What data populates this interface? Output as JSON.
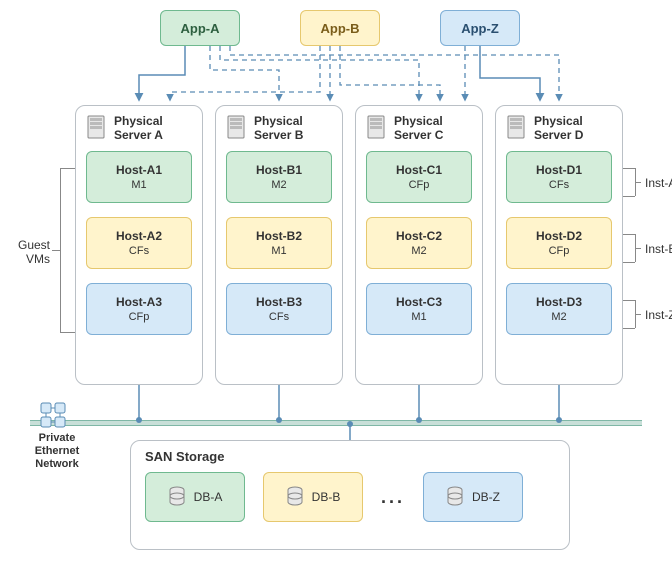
{
  "apps": [
    {
      "label": "App-A",
      "color": "green"
    },
    {
      "label": "App-B",
      "color": "yellow"
    },
    {
      "label": "App-Z",
      "color": "blue"
    }
  ],
  "servers": [
    {
      "title": "Physical\nServer A",
      "hosts": [
        {
          "name": "Host-A1",
          "role": "M1",
          "color": "green"
        },
        {
          "name": "Host-A2",
          "role": "CFs",
          "color": "yellow"
        },
        {
          "name": "Host-A3",
          "role": "CFp",
          "color": "blue"
        }
      ]
    },
    {
      "title": "Physical\nServer B",
      "hosts": [
        {
          "name": "Host-B1",
          "role": "M2",
          "color": "green"
        },
        {
          "name": "Host-B2",
          "role": "M1",
          "color": "yellow"
        },
        {
          "name": "Host-B3",
          "role": "CFs",
          "color": "blue"
        }
      ]
    },
    {
      "title": "Physical\nServer C",
      "hosts": [
        {
          "name": "Host-C1",
          "role": "CFp",
          "color": "green"
        },
        {
          "name": "Host-C2",
          "role": "M2",
          "color": "yellow"
        },
        {
          "name": "Host-C3",
          "role": "M1",
          "color": "blue"
        }
      ]
    },
    {
      "title": "Physical\nServer D",
      "hosts": [
        {
          "name": "Host-D1",
          "role": "CFs",
          "color": "green"
        },
        {
          "name": "Host-D2",
          "role": "CFp",
          "color": "yellow"
        },
        {
          "name": "Host-D3",
          "role": "M2",
          "color": "blue"
        }
      ]
    }
  ],
  "san": {
    "title": "SAN Storage",
    "dbs": [
      {
        "label": "DB-A",
        "color": "green"
      },
      {
        "label": "DB-B",
        "color": "yellow"
      },
      {
        "label": "DB-Z",
        "color": "blue"
      }
    ],
    "ellipsis": "..."
  },
  "labels": {
    "guest_vms": "Guest\nVMs",
    "private_eth": "Private\nEthernet\nNetwork",
    "inst_a": "Inst-A",
    "inst_b": "Inst-B",
    "inst_z": "Inst-Z"
  },
  "colors": {
    "green_fill": "#d4edda",
    "yellow_fill": "#fff4cc",
    "blue_fill": "#d6e9f8",
    "connector": "#5a8cb5",
    "dashed": "#5a8cb5"
  }
}
